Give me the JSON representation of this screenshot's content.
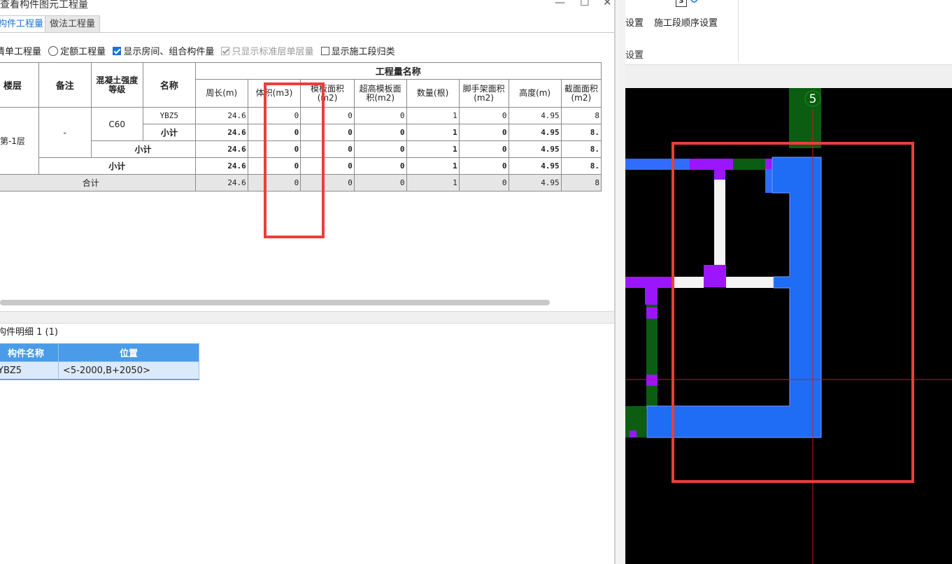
{
  "window": {
    "title": "查看构件图元工程量",
    "minimize": "—",
    "maximize": "☐",
    "close": "✕"
  },
  "tabs": [
    {
      "label": "构件工程量",
      "active": true
    },
    {
      "label": "做法工程量",
      "active": false
    }
  ],
  "options": {
    "radio_qingdan": "清单工程量",
    "radio_dinge": "定额工程量",
    "cb_show_room": "显示房间、组合构件量",
    "cb_std_floor": "只显示标准层单层量",
    "cb_construction": "显示施工段归类"
  },
  "table": {
    "headers": {
      "floor": "楼层",
      "note": "备注",
      "concrete": "混凝土强度等级",
      "name": "名称",
      "group": "工程量名称",
      "cols": [
        "周长(m)",
        "体积(m3)",
        "模板面积(m2)",
        "超高模板面积(m2)",
        "数量(根)",
        "脚手架面积(m2)",
        "高度(m)",
        "截面面积(m2)"
      ]
    },
    "floor_value": "第-1层",
    "note_value": "-",
    "concrete_value": "C60",
    "rows": [
      {
        "label": "YBZ5",
        "values": [
          "24.6",
          "0",
          "0",
          "0",
          "1",
          "0",
          "4.95",
          "8"
        ]
      },
      {
        "label": "小计",
        "values": [
          "24.6",
          "0",
          "0",
          "0",
          "1",
          "0",
          "4.95",
          "8."
        ]
      },
      {
        "label": "小计",
        "values": [
          "24.6",
          "0",
          "0",
          "0",
          "1",
          "0",
          "4.95",
          "8."
        ]
      },
      {
        "label": "小计",
        "values": [
          "24.6",
          "0",
          "0",
          "0",
          "1",
          "0",
          "4.95",
          "8."
        ]
      },
      {
        "label": "合计",
        "values": [
          "24.6",
          "0",
          "0",
          "0",
          "1",
          "0",
          "4.95",
          "8"
        ]
      }
    ]
  },
  "detail": {
    "header": "构件明细 1 (1)",
    "col_name": "构件名称",
    "col_pos": "位置",
    "row_name": "YBZ5",
    "row_pos": "<5-2000,B+2050>"
  },
  "ribbon": {
    "btn1": "设置",
    "btn2": "施工段顺序设置",
    "group": "设置"
  },
  "canvas": {
    "axis_label": "5"
  },
  "colors": {
    "accent": "#1a73d8",
    "highlight": "#e8403a",
    "wall_blue": "#2f6cff",
    "column_blue": "#1f6cf5",
    "purple": "#9b16ff",
    "green": "#0b5d12"
  }
}
